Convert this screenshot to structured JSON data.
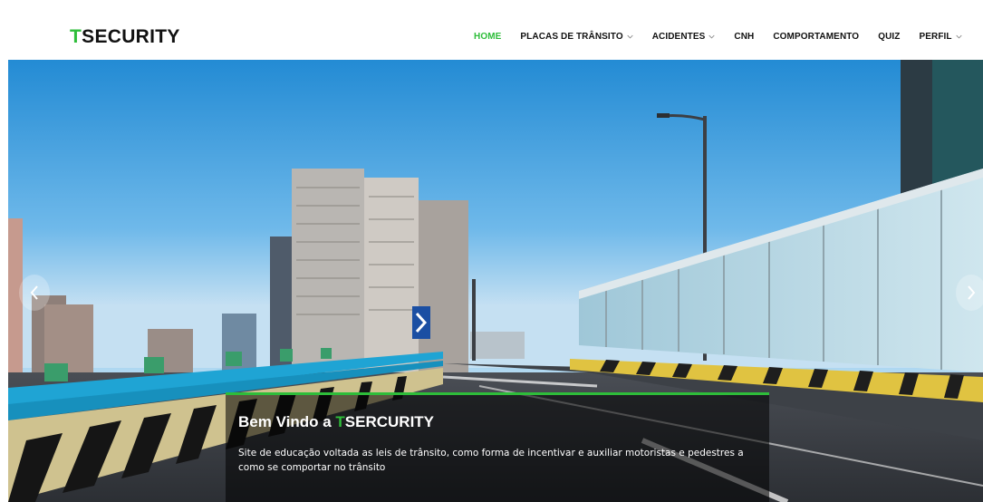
{
  "brand": {
    "accent_letter": "T",
    "rest": "SECURITY",
    "accent_color": "#2ebd3a"
  },
  "nav": {
    "items": [
      {
        "label": "HOME",
        "active": true,
        "dropdown": false
      },
      {
        "label": "PLACAS DE TRÂNSITO",
        "active": false,
        "dropdown": true
      },
      {
        "label": "ACIDENTES",
        "active": false,
        "dropdown": true
      },
      {
        "label": "CNH",
        "active": false,
        "dropdown": false
      },
      {
        "label": "COMPORTAMENTO",
        "active": false,
        "dropdown": false
      },
      {
        "label": "QUIZ",
        "active": false,
        "dropdown": false
      },
      {
        "label": "PERFIL",
        "active": false,
        "dropdown": true
      }
    ]
  },
  "hero": {
    "caption": {
      "title_prefix": "Bem Vindo a ",
      "title_accent": "T",
      "title_rest": "SERCURITY",
      "text": "Site de educação voltada as leis de trânsito, como forma de incentivar e auxiliar motoristas e pedestres a como se comportar no trânsito"
    },
    "prev_icon": "chevron-left-icon",
    "next_icon": "chevron-right-icon"
  }
}
